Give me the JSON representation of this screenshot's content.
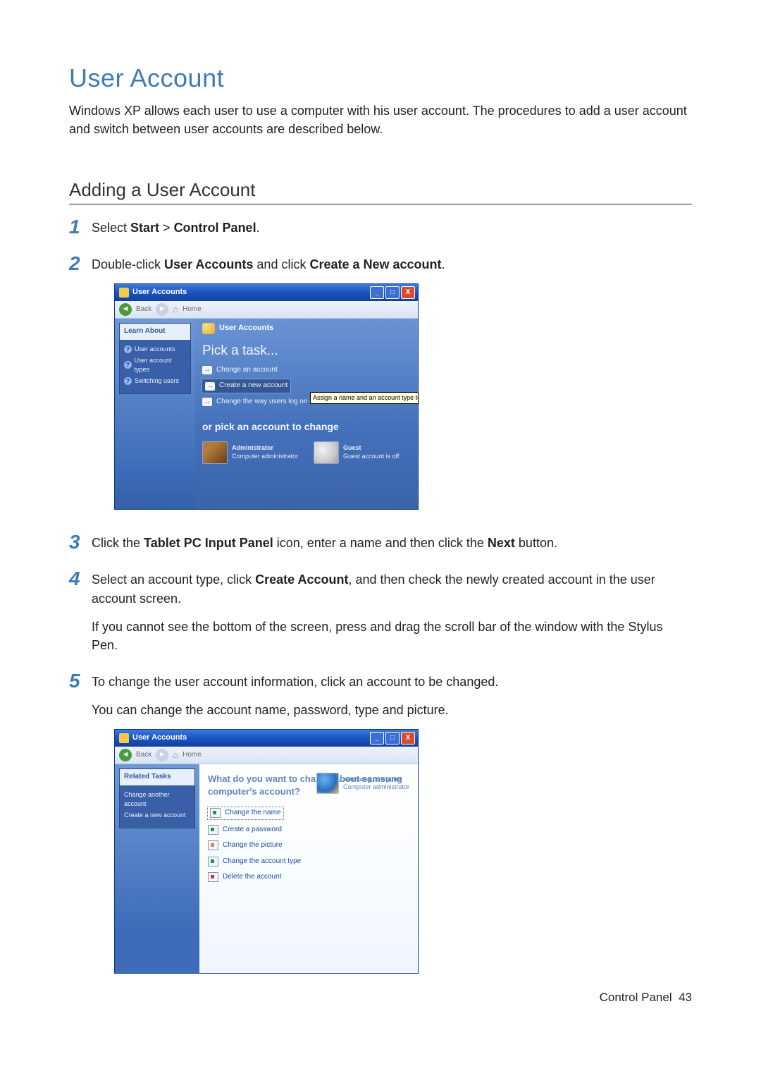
{
  "page": {
    "title": "User Account",
    "intro": "Windows XP allows each user to use a computer with his user account. The procedures to add a user account and switch between user accounts are described below.",
    "section_heading": "Adding a User Account",
    "footer_label": "Control Panel",
    "footer_page": "43"
  },
  "steps": {
    "s1_pre": "Select ",
    "s1_b1": "Start",
    "s1_mid": " > ",
    "s1_b2": "Control Panel",
    "s1_post": ".",
    "s2_pre": "Double-click ",
    "s2_b1": "User Accounts",
    "s2_mid": " and click ",
    "s2_b2": "Create a New account",
    "s2_post": ".",
    "s3_pre": "Click the ",
    "s3_b1": "Tablet PC Input Panel",
    "s3_mid": " icon, enter a name and then click the ",
    "s3_b2": "Next",
    "s3_post": " button.",
    "s4_pre": "Select an account type, click ",
    "s4_b1": "Create Account",
    "s4_post": ", and then check the newly created account in the user account screen.",
    "s4_para2": "If you cannot see the bottom of the screen, press and drag the scroll bar of the window with the Stylus Pen.",
    "s5_line1": "To change the user account information, click an account to be changed.",
    "s5_line2": "You can change the account name, password, type and picture."
  },
  "shot1": {
    "title": "User Accounts",
    "back": "Back",
    "home": "Home",
    "learn_about": "Learn About",
    "learn_items": [
      "User accounts",
      "User account types",
      "Switching users"
    ],
    "crumb": "User Accounts",
    "pick_heading": "Pick a task...",
    "tasks": {
      "change": "Change an account",
      "create": "Create a new account",
      "logonoff": "Change the way users log on or off"
    },
    "tooltip": "Assign a name and an account type to a new acc",
    "orpick": "or pick an account to change",
    "admin_name": "Administrator",
    "admin_sub": "Computer administrator",
    "guest_name": "Guest",
    "guest_sub": "Guest account is off"
  },
  "shot2": {
    "title": "User Accounts",
    "back": "Back",
    "home": "Home",
    "related": "Related Tasks",
    "related_items": [
      "Change another account",
      "Create a new account"
    ],
    "question": "What do you want to change about samsung computer's account?",
    "items": {
      "name": "Change the name",
      "pwd": "Create a password",
      "pic": "Change the picture",
      "type": "Change the account type",
      "del": "Delete the account"
    },
    "acct_name": "samsung computer",
    "acct_sub": "Computer administrator"
  }
}
